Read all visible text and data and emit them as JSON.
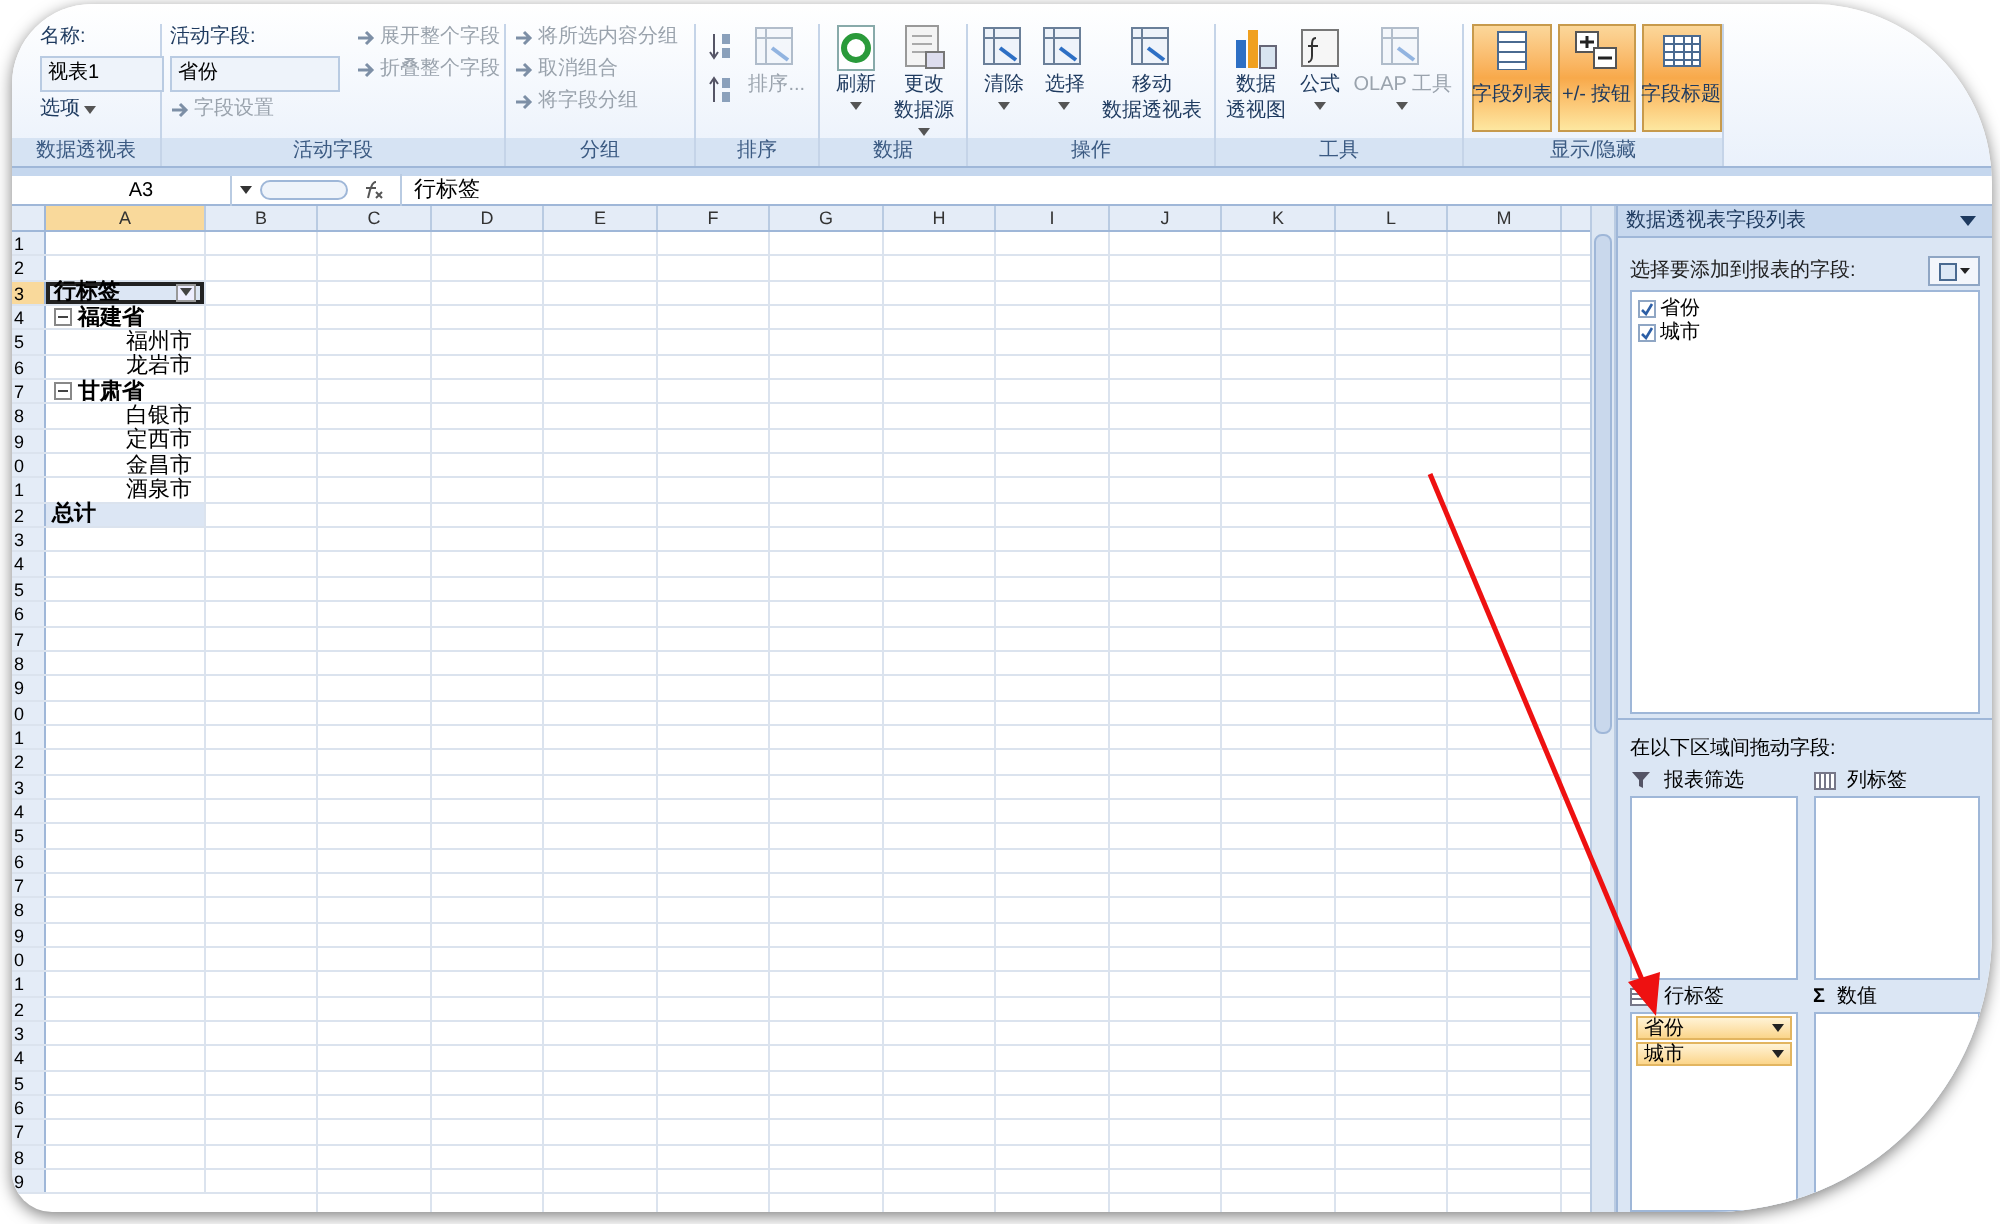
{
  "ribbon": {
    "groups": [
      {
        "label": "数据透视表",
        "controls": [
          {
            "kind": "label",
            "text": "名称:"
          },
          {
            "kind": "field",
            "text": "视表1"
          },
          {
            "kind": "menu",
            "text": "选项"
          }
        ]
      },
      {
        "label": "活动字段",
        "controls": [
          {
            "kind": "label",
            "text": "活动字段:"
          },
          {
            "kind": "field",
            "text": "省份"
          },
          {
            "kind": "small",
            "text": "字段设置",
            "disabled": true
          },
          {
            "kind": "small",
            "text": "展开整个字段",
            "disabled": true
          },
          {
            "kind": "small",
            "text": "折叠整个字段",
            "disabled": true
          }
        ]
      },
      {
        "label": "分组",
        "controls": [
          {
            "kind": "small",
            "text": "将所选内容分组",
            "disabled": true
          },
          {
            "kind": "small",
            "text": "取消组合",
            "disabled": true
          },
          {
            "kind": "small",
            "text": "将字段分组",
            "disabled": true
          }
        ]
      },
      {
        "label": "排序",
        "controls": [
          {
            "kind": "sort"
          },
          {
            "kind": "large",
            "lines": [
              "排序..."
            ],
            "disabled": true
          }
        ]
      },
      {
        "label": "数据",
        "controls": [
          {
            "kind": "large",
            "lines": [
              "刷新"
            ],
            "caret": true,
            "disabled": false
          },
          {
            "kind": "large",
            "lines": [
              "更改",
              "数据源"
            ],
            "caret": true,
            "disabled": false
          }
        ]
      },
      {
        "label": "操作",
        "controls": [
          {
            "kind": "large",
            "lines": [
              "清除"
            ],
            "caret": true,
            "disabled": false
          },
          {
            "kind": "large",
            "lines": [
              "选择"
            ],
            "caret": true,
            "disabled": false
          },
          {
            "kind": "large",
            "lines": [
              "移动",
              "数据透视表"
            ],
            "disabled": false
          }
        ]
      },
      {
        "label": "工具",
        "controls": [
          {
            "kind": "large",
            "lines": [
              "数据",
              "透视图"
            ],
            "disabled": false
          },
          {
            "kind": "large",
            "lines": [
              "公式"
            ],
            "caret": true,
            "disabled": false
          },
          {
            "kind": "large",
            "lines": [
              "OLAP 工具"
            ],
            "caret": true,
            "disabled": true
          }
        ]
      },
      {
        "label": "显示/隐藏",
        "controls": [
          {
            "kind": "toggle",
            "text": "字段列表",
            "on": true
          },
          {
            "kind": "toggle",
            "text": "+/- 按钮",
            "on": true
          },
          {
            "kind": "toggle",
            "text": "字段标题",
            "on": true
          }
        ]
      }
    ]
  },
  "formula_bar": {
    "name_box": "A3",
    "formula": "行标签"
  },
  "sheet": {
    "columns": [
      "A",
      "B",
      "C",
      "D",
      "E",
      "F",
      "G",
      "H",
      "I",
      "J",
      "K",
      "L",
      "M"
    ],
    "row_numbers": [
      "1",
      "2",
      "3",
      "4",
      "5",
      "6",
      "7",
      "8",
      "9",
      "0",
      "1",
      "2",
      "3",
      "4",
      "5",
      "6",
      "7",
      "8",
      "9",
      "0",
      "1",
      "2",
      "3",
      "4",
      "5",
      "6",
      "7",
      "8",
      "9",
      "0",
      "1",
      "2",
      "3",
      "4",
      "5",
      "6",
      "7",
      "8",
      "9"
    ],
    "pivot_rows": [
      {
        "kind": "header",
        "text": "行标签",
        "selected": true
      },
      {
        "kind": "group",
        "text": "福建省",
        "selected": false
      },
      {
        "kind": "item",
        "text": "福州市",
        "selected": false
      },
      {
        "kind": "item",
        "text": "龙岩市",
        "selected": false
      },
      {
        "kind": "group",
        "text": "甘肃省",
        "selected": false
      },
      {
        "kind": "item",
        "text": "白银市",
        "selected": false
      },
      {
        "kind": "item",
        "text": "定西市",
        "selected": false
      },
      {
        "kind": "item",
        "text": "金昌市",
        "selected": false
      },
      {
        "kind": "item",
        "text": "酒泉市",
        "selected": false
      },
      {
        "kind": "total",
        "text": "总计",
        "selected": false
      }
    ]
  },
  "field_list": {
    "title": "数据透视表字段列表",
    "prompt": "选择要添加到报表的字段:",
    "fields": [
      {
        "label": "省份",
        "checked": true
      },
      {
        "label": "城市",
        "checked": true
      }
    ],
    "drag_prompt": "在以下区域间拖动字段:",
    "areas": [
      {
        "kind": "filter",
        "label": "报表筛选"
      },
      {
        "kind": "columns",
        "label": "列标签"
      },
      {
        "kind": "rows",
        "label": "行标签",
        "items": [
          "省份",
          "城市"
        ]
      },
      {
        "kind": "values",
        "label": "数值",
        "symbol": "Σ"
      }
    ]
  }
}
